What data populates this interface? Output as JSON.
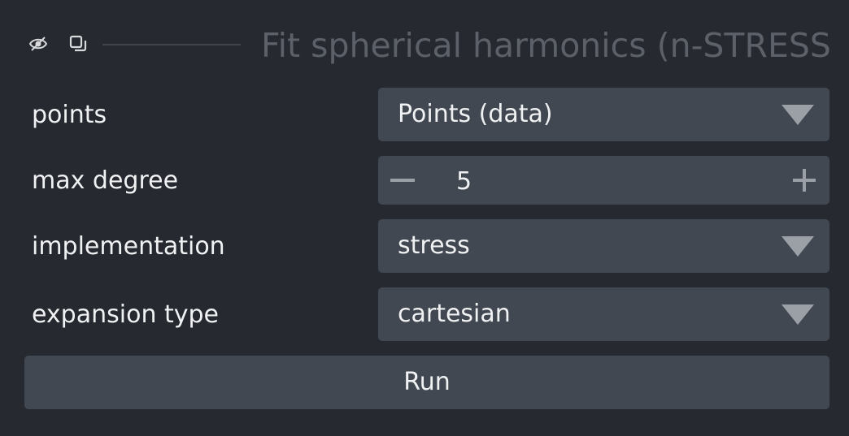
{
  "titlebar": {
    "title": "Fit spherical harmonics (n-STRESS",
    "visibility_icon": "eye-slash-icon",
    "float_icon": "float-window-icon"
  },
  "fields": [
    {
      "label": "points",
      "value": "Points (data)",
      "widget": "dropdown"
    },
    {
      "label": "max degree",
      "value": "5",
      "widget": "spinbox"
    },
    {
      "label": "implementation",
      "value": "stress",
      "widget": "dropdown"
    },
    {
      "label": "expansion type",
      "value": "cartesian",
      "widget": "dropdown"
    }
  ],
  "run_button": {
    "label": "Run"
  },
  "colors": {
    "background": "#262930",
    "control": "#414851",
    "text": "#f0f1f2",
    "muted": "#9ba0a6"
  }
}
